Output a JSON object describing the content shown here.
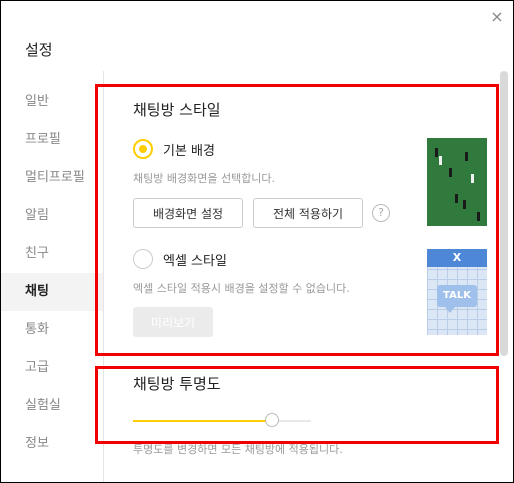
{
  "window": {
    "title": "설정",
    "close_glyph": "×"
  },
  "sidebar": {
    "items": [
      {
        "label": "일반",
        "active": false
      },
      {
        "label": "프로필",
        "active": false
      },
      {
        "label": "멀티프로필",
        "active": false
      },
      {
        "label": "알림",
        "active": false
      },
      {
        "label": "친구",
        "active": false
      },
      {
        "label": "채팅",
        "active": true
      },
      {
        "label": "통화",
        "active": false
      },
      {
        "label": "고급",
        "active": false
      },
      {
        "label": "실험실",
        "active": false
      },
      {
        "label": "정보",
        "active": false
      }
    ]
  },
  "chatroom_style": {
    "title": "채팅방 스타일",
    "default_bg": {
      "label": "기본 배경",
      "selected": true,
      "description": "채팅방 배경화면을 선택합니다.",
      "set_wallpaper_button": "배경화면 설정",
      "apply_all_button": "전체 적용하기",
      "help_glyph": "?"
    },
    "excel_style": {
      "label": "엑셀 스타일",
      "selected": false,
      "description": "엑셀 스타일 적용시 배경을 설정할 수 없습니다.",
      "preview_button": "미리보기",
      "thumb_header": "X",
      "thumb_bubble": "TALK"
    }
  },
  "transparency": {
    "title": "채팅방 투명도",
    "value_percent": 78,
    "description": "투명도를 변경하면 모든 채팅방에 적용됩니다."
  },
  "colors": {
    "accent": "#ffcd00",
    "highlight": "#f20000"
  }
}
